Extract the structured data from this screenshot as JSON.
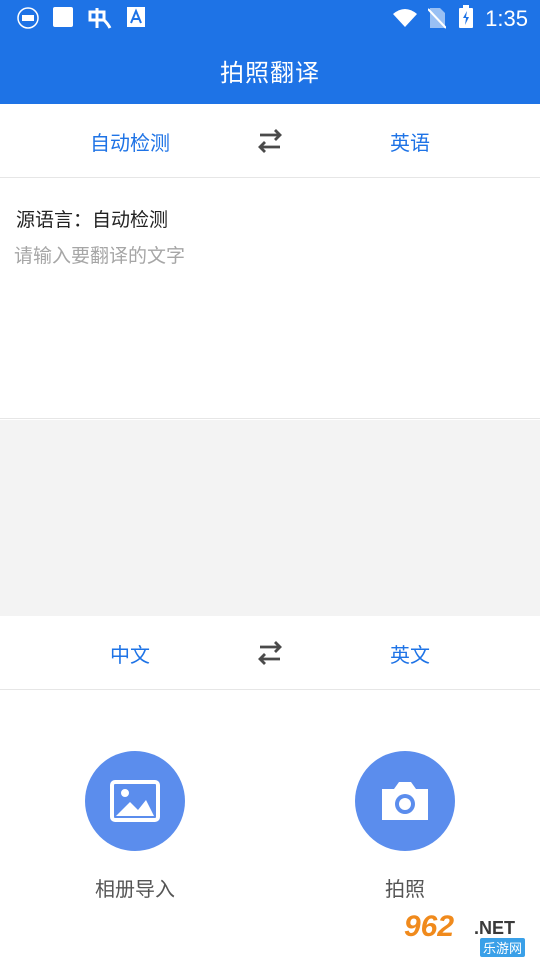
{
  "statusbar": {
    "time": "1:35",
    "left_icons": [
      "app-badge-icon",
      "square-notification-icon",
      "app-logo-icon",
      "text-app-icon"
    ],
    "right_icons": [
      "wifi-icon",
      "no-sim-icon",
      "battery-charging-icon"
    ]
  },
  "appbar": {
    "title": "拍照翻译"
  },
  "text_lang_row": {
    "source": "自动检测",
    "target": "英语",
    "swap_icon": "swap-arrows-icon"
  },
  "input": {
    "source_label": "源语言：自动检测",
    "placeholder": "请输入要翻译的文字",
    "value": ""
  },
  "photo_lang_row": {
    "source": "中文",
    "target": "英文",
    "swap_icon": "swap-arrows-icon"
  },
  "actions": {
    "album_label": "相册导入",
    "album_icon": "image-icon",
    "camera_label": "拍照",
    "camera_icon": "camera-icon"
  },
  "watermark": {
    "number": "962",
    "suffix": ".NET",
    "cn": "乐游网"
  },
  "colors": {
    "primary": "#1e73e6",
    "action_circle": "#5b8ded",
    "divider": "#e6e6e6",
    "panel_gray": "#f3f3f3"
  }
}
